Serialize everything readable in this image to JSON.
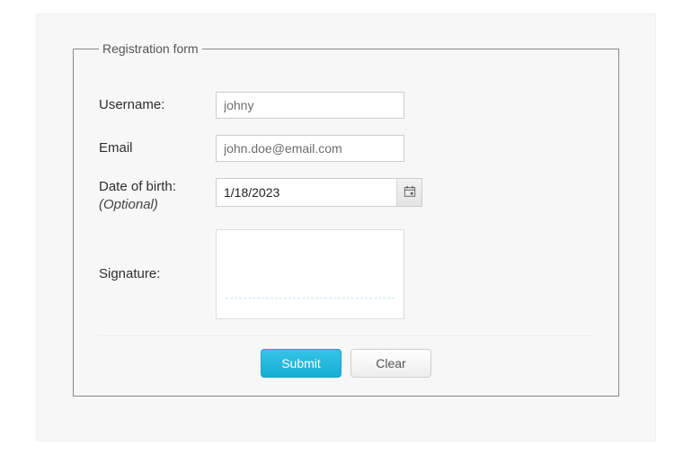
{
  "form": {
    "legend": "Registration form",
    "username": {
      "label": "Username:",
      "value": "johny"
    },
    "email": {
      "label": "Email",
      "value": "john.doe@email.com"
    },
    "dob": {
      "label": "Date of birth:",
      "hint": "(Optional)",
      "value": "1/18/2023"
    },
    "signature": {
      "label": "Signature:"
    },
    "buttons": {
      "submit": "Submit",
      "clear": "Clear"
    }
  },
  "icons": {
    "calendar": "calendar-icon"
  }
}
